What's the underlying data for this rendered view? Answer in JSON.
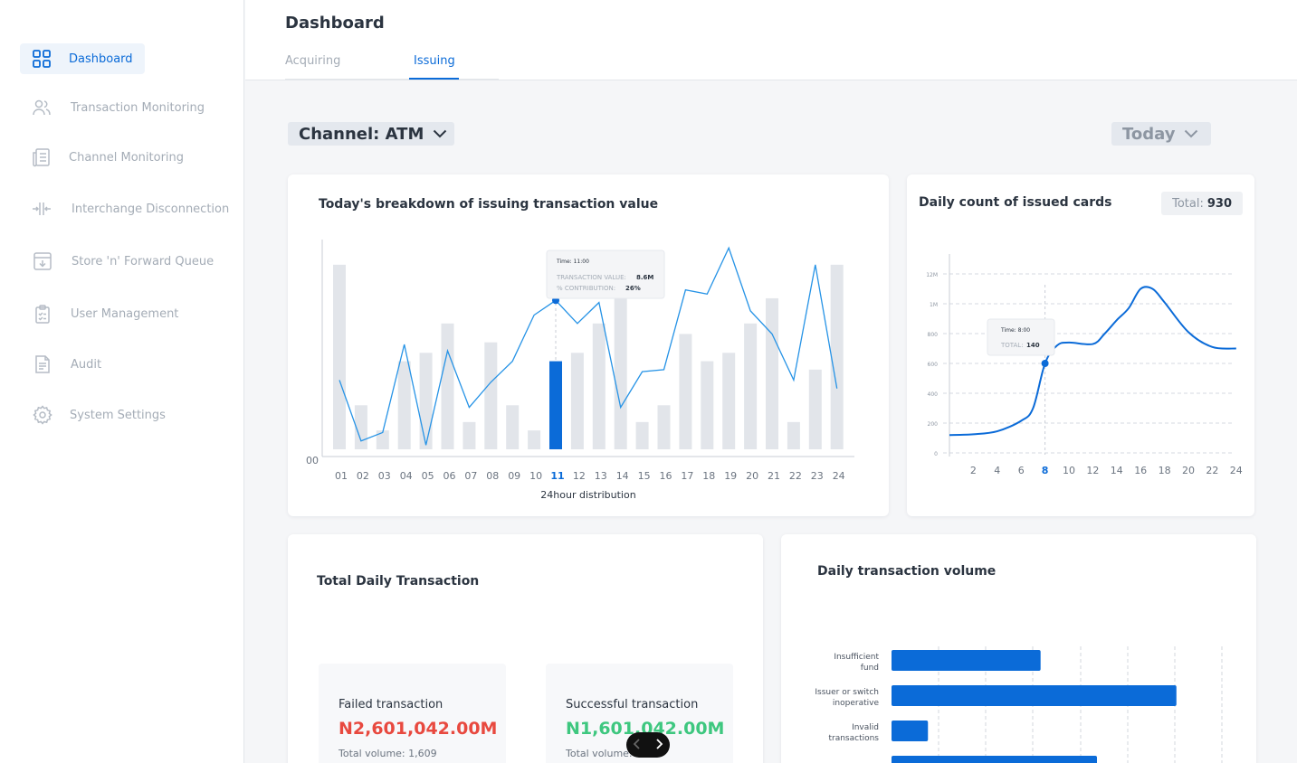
{
  "sidebar": {
    "items": [
      {
        "label": "Dashboard",
        "icon": "grid-icon",
        "active": true
      },
      {
        "label": "Transaction Monitoring",
        "icon": "users-icon"
      },
      {
        "label": "Channel Monitoring",
        "icon": "document-list-icon"
      },
      {
        "label": "Interchange Disconnection",
        "icon": "disconnect-icon"
      },
      {
        "label": "Store 'n' Forward Queue",
        "icon": "inbox-download-icon"
      },
      {
        "label": "User Management",
        "icon": "clipboard-check-icon"
      },
      {
        "label": "Audit",
        "icon": "file-text-icon"
      },
      {
        "label": "System Settings",
        "icon": "gear-icon"
      }
    ]
  },
  "header": {
    "title": "Dashboard",
    "tabs": [
      {
        "label": "Acquiring"
      },
      {
        "label": "Issuing",
        "active": true
      }
    ]
  },
  "filters": {
    "channel": "Channel: ATM",
    "period": "Today"
  },
  "colors": {
    "accent": "#0b6bd8",
    "bar": "#e2e5ea",
    "failed": "#e8493f",
    "success": "#3ec77f"
  },
  "breakdown_card": {
    "title": "Today's breakdown of issuing transaction value",
    "tooltip": {
      "time": "Time: 11:00",
      "value_label": "TRANSACTION VALUE:",
      "value": "8.6M",
      "contribution_label": "% CONTRIBUTION:",
      "contribution": "26%"
    }
  },
  "cards_count_card": {
    "title": "Daily count of issued cards",
    "total_label": "Total:",
    "total_value": "930",
    "tooltip": {
      "time": "Time: 8:00",
      "total_label": "TOTAL:",
      "total_value": "140"
    }
  },
  "total_daily_card": {
    "title": "Total Daily Transaction",
    "failed": {
      "title": "Failed transaction",
      "value": "N2,601,042.00M",
      "volume": "Total volume: 1,609"
    },
    "successful": {
      "title": "Successful transaction",
      "value": "N1,601,042.00M",
      "volume": "Total volume:"
    }
  },
  "volume_card": {
    "title": "Daily transaction volume"
  },
  "chart_data": [
    {
      "type": "bar",
      "title": "Today's breakdown of issuing transaction value",
      "xlabel": "24hour distribution",
      "ylabel": "",
      "categories": [
        "01",
        "02",
        "03",
        "04",
        "05",
        "06",
        "07",
        "08",
        "09",
        "10",
        "11",
        "12",
        "13",
        "14",
        "15",
        "16",
        "17",
        "18",
        "19",
        "20",
        "21",
        "22",
        "23",
        "24"
      ],
      "y_tick_labels": [
        "00"
      ],
      "ylim": [
        0,
        100
      ],
      "highlighted_category": "11",
      "series": [
        {
          "type": "bar",
          "values": [
            88,
            21,
            9,
            42,
            46,
            60,
            13,
            51,
            21,
            9,
            42,
            46,
            60,
            84,
            13,
            21,
            55,
            42,
            46,
            60,
            72,
            13,
            38,
            88
          ]
        },
        {
          "type": "line",
          "values": [
            33,
            4,
            8,
            50,
            2,
            47,
            20,
            32,
            42,
            64,
            71,
            60,
            70,
            20,
            37,
            38,
            76,
            74,
            96,
            66,
            55,
            33,
            88,
            29
          ]
        }
      ],
      "grid": false,
      "legend": "none"
    },
    {
      "type": "line",
      "title": "Daily count of issued cards",
      "x": [
        0,
        2,
        4,
        6,
        7,
        8,
        9,
        10,
        12,
        13,
        14,
        15,
        16,
        17,
        18,
        20,
        22,
        24
      ],
      "x_tick_labels": [
        "2",
        "4",
        "6",
        "8",
        "10",
        "12",
        "14",
        "16",
        "18",
        "20",
        "22",
        "24"
      ],
      "highlighted_x": "8",
      "y_tick_labels": [
        "0",
        "200",
        "400",
        "600",
        "800",
        "1M",
        "12M"
      ],
      "xlim": [
        0,
        24
      ],
      "ylim": [
        0,
        1200
      ],
      "series": [
        {
          "values": [
            120,
            125,
            145,
            215,
            300,
            600,
            720,
            740,
            730,
            800,
            890,
            970,
            1100,
            1100,
            1010,
            810,
            710,
            700
          ]
        }
      ],
      "grid": "dashed-horizontal",
      "legend": "none"
    },
    {
      "type": "bar",
      "orientation": "horizontal",
      "title": "Daily transaction volume",
      "categories": [
        "Insufficient fund",
        "Issuer or switch inoperative",
        "Invalid transactions"
      ],
      "values": [
        45,
        86,
        11
      ],
      "xlim": [
        0,
        100
      ],
      "grid": "dashed-vertical",
      "legend": "none"
    }
  ]
}
